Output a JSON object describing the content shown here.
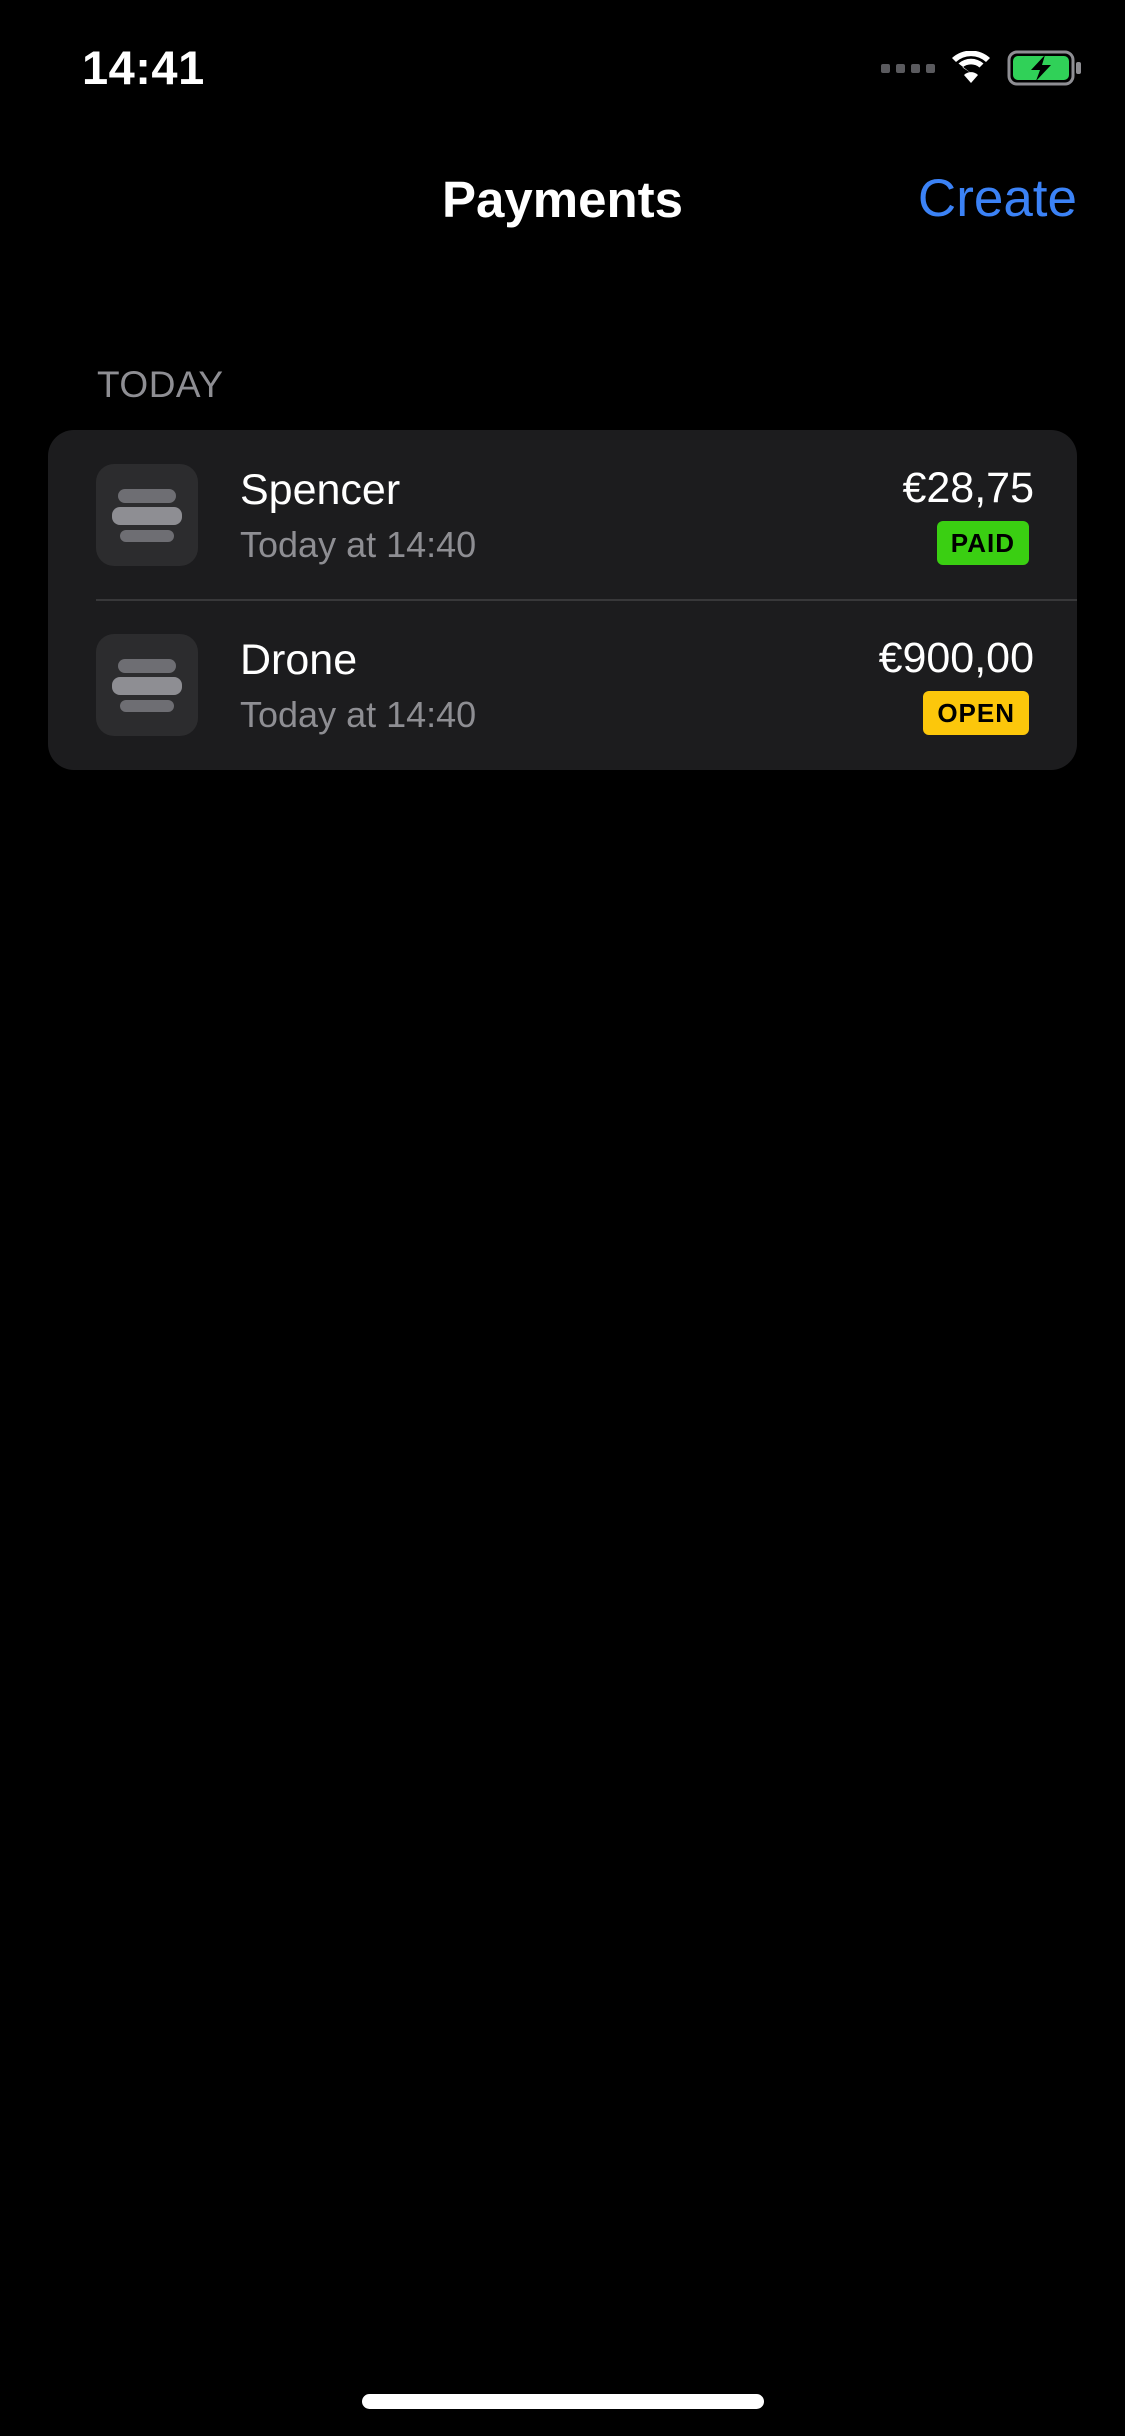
{
  "status_bar": {
    "time": "14:41",
    "icons": [
      "signal-icon",
      "wifi-icon",
      "battery-charging-icon"
    ],
    "battery_color": "#30d158"
  },
  "nav": {
    "title": "Payments",
    "create_label": "Create",
    "accent_color": "#3b82f6"
  },
  "section": {
    "title": "TODAY"
  },
  "payments": [
    {
      "name": "Spencer",
      "time": "Today at 14:40",
      "amount": "€28,75",
      "status": "PAID",
      "status_color": "#3acf12"
    },
    {
      "name": "Drone",
      "time": "Today at 14:40",
      "amount": "€900,00",
      "status": "OPEN",
      "status_color": "#fcc70b"
    }
  ]
}
